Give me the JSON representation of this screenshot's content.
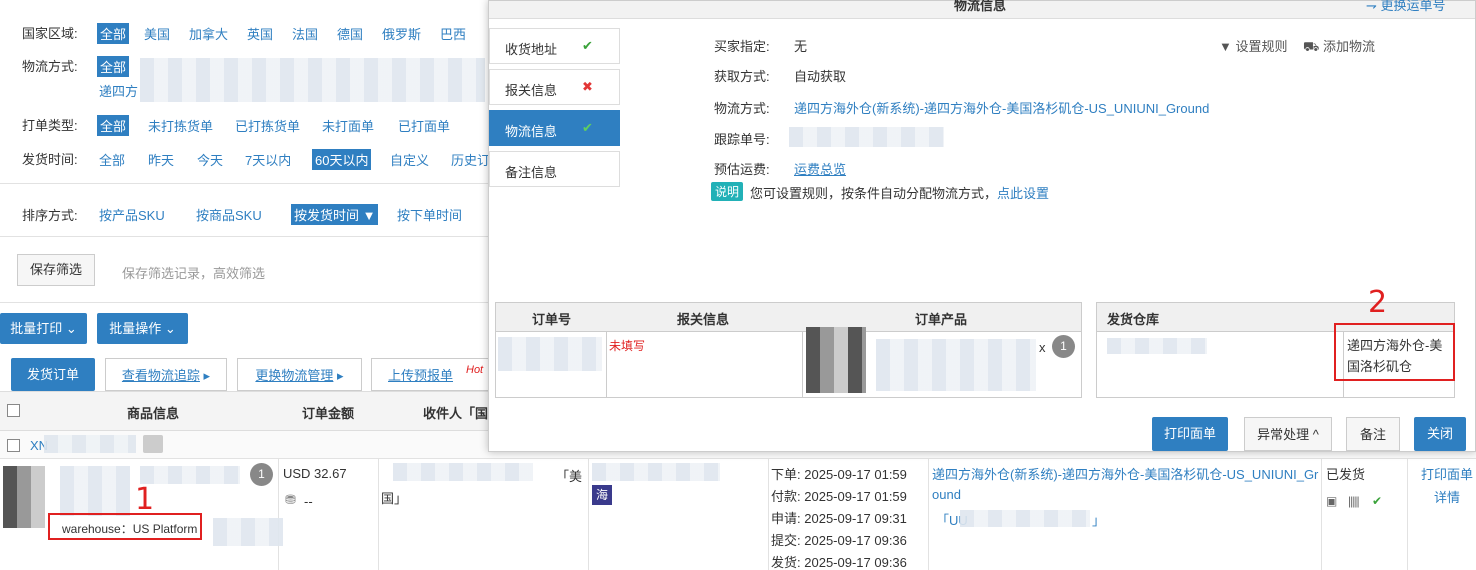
{
  "filters": {
    "country": {
      "label": "国家区域:",
      "options": [
        "全部",
        "美国",
        "加拿大",
        "英国",
        "法国",
        "德国",
        "俄罗斯",
        "巴西"
      ]
    },
    "logistics": {
      "label": "物流方式:",
      "selected": "全部",
      "sub": "递四方"
    },
    "print_type": {
      "label": "打单类型:",
      "options": [
        "全部",
        "未打拣货单",
        "已打拣货单",
        "未打面单",
        "已打面单"
      ]
    },
    "ship_time": {
      "label": "发货时间:",
      "options": [
        "全部",
        "昨天",
        "今天",
        "7天以内",
        "60天以内",
        "自定义",
        "历史订"
      ]
    },
    "sort": {
      "label": "排序方式:",
      "options": [
        "按产品SKU",
        "按商品SKU",
        "按发货时间 ▼",
        "按下单时间"
      ]
    },
    "save_filter": "保存筛选",
    "save_hint": "保存筛选记录，高效筛选"
  },
  "toolbar": {
    "batch_print": "批量打印",
    "batch_ops": "批量操作"
  },
  "tabs": {
    "ship_order": "发货订单",
    "track": "查看物流追踪",
    "change_logistics": "更换物流管理",
    "upload": "上传预报单",
    "hot": "Hot"
  },
  "table": {
    "headers": [
      "商品信息",
      "订单金额",
      "收件人「国"
    ],
    "group_prefix": "XN",
    "amount": "USD 32.67",
    "amount_sub": "--",
    "quantity": "1",
    "country_a": "「美",
    "country_b": "国」",
    "sea_badge": "海",
    "times": [
      {
        "label": "下单:",
        "value": "2025-09-17 01:59"
      },
      {
        "label": "付款:",
        "value": "2025-09-17 01:59"
      },
      {
        "label": "申请:",
        "value": "2025-09-17 09:31"
      },
      {
        "label": "提交:",
        "value": "2025-09-17 09:36"
      },
      {
        "label": "发货:",
        "value": "2025-09-17 09:36"
      }
    ],
    "logistics_line1": "递四方海外仓(新系统)-递四方海外仓-美国洛杉矶仓-US_UNIUNI_Gr",
    "logistics_line2": "ound",
    "logistics_line3_a": "「UU",
    "logistics_line3_b": "」",
    "status": "已发货",
    "action_print": "打印面单",
    "action_detail": "详情",
    "warehouse_tag": "warehouse：US Platform"
  },
  "modal": {
    "title": "物流信息",
    "change_tracking": "更换运单号",
    "side_tabs": [
      {
        "label": "收货地址",
        "mark": "✔",
        "state": "ok"
      },
      {
        "label": "报关信息",
        "mark": "✖",
        "state": "error"
      },
      {
        "label": "物流信息",
        "mark": "✔",
        "state": "active"
      },
      {
        "label": "备注信息",
        "mark": "",
        "state": "none"
      }
    ],
    "fields": {
      "buyer_label": "买家指定:",
      "buyer_value": "无",
      "get_label": "获取方式:",
      "get_value": "自动获取",
      "method_label": "物流方式:",
      "method_value": "递四方海外仓(新系统)-递四方海外仓-美国洛杉矶仓-US_UNIUNI_Ground",
      "track_label": "跟踪单号:",
      "fee_label": "预估运费:",
      "fee_value": "运费总览"
    },
    "set_rules": "设置规则",
    "add_logistics": "添加物流",
    "note_badge": "说明",
    "note_text": "您可设置规则，按条件自动分配物流方式，",
    "note_link": "点此设置",
    "order_table": {
      "headers": [
        "订单号",
        "报关信息",
        "订单产品"
      ],
      "quantity": "1",
      "times": "x",
      "red_text": "未填写"
    },
    "warehouse_table": {
      "header": "发货仓库",
      "value": "递四方海外仓-美国洛杉矶仓"
    },
    "buttons": {
      "print": "打印面单",
      "exception": "异常处理 ^",
      "note": "备注",
      "close": "关闭"
    }
  },
  "annotations": {
    "one": "1",
    "two": "2"
  },
  "colors": {
    "primary": "#2f7fc1",
    "success": "#3aa23a",
    "danger": "#e23636",
    "annotation": "#e02020",
    "teal_badge": "#22b1b7"
  }
}
